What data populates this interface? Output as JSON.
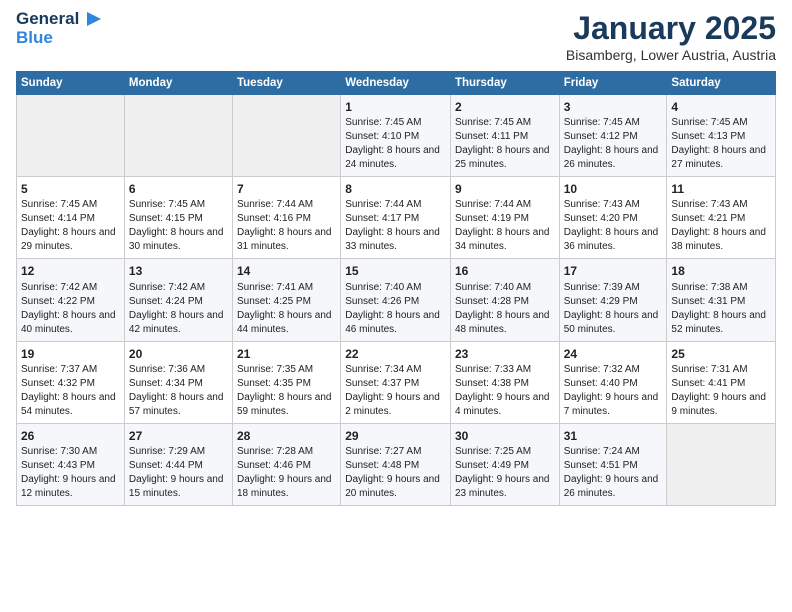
{
  "header": {
    "logo_line1": "General",
    "logo_line2": "Blue",
    "title": "January 2025",
    "location": "Bisamberg, Lower Austria, Austria"
  },
  "weekdays": [
    "Sunday",
    "Monday",
    "Tuesday",
    "Wednesday",
    "Thursday",
    "Friday",
    "Saturday"
  ],
  "weeks": [
    [
      {
        "day": "",
        "info": ""
      },
      {
        "day": "",
        "info": ""
      },
      {
        "day": "",
        "info": ""
      },
      {
        "day": "1",
        "info": "Sunrise: 7:45 AM\nSunset: 4:10 PM\nDaylight: 8 hours\nand 24 minutes."
      },
      {
        "day": "2",
        "info": "Sunrise: 7:45 AM\nSunset: 4:11 PM\nDaylight: 8 hours\nand 25 minutes."
      },
      {
        "day": "3",
        "info": "Sunrise: 7:45 AM\nSunset: 4:12 PM\nDaylight: 8 hours\nand 26 minutes."
      },
      {
        "day": "4",
        "info": "Sunrise: 7:45 AM\nSunset: 4:13 PM\nDaylight: 8 hours\nand 27 minutes."
      }
    ],
    [
      {
        "day": "5",
        "info": "Sunrise: 7:45 AM\nSunset: 4:14 PM\nDaylight: 8 hours\nand 29 minutes."
      },
      {
        "day": "6",
        "info": "Sunrise: 7:45 AM\nSunset: 4:15 PM\nDaylight: 8 hours\nand 30 minutes."
      },
      {
        "day": "7",
        "info": "Sunrise: 7:44 AM\nSunset: 4:16 PM\nDaylight: 8 hours\nand 31 minutes."
      },
      {
        "day": "8",
        "info": "Sunrise: 7:44 AM\nSunset: 4:17 PM\nDaylight: 8 hours\nand 33 minutes."
      },
      {
        "day": "9",
        "info": "Sunrise: 7:44 AM\nSunset: 4:19 PM\nDaylight: 8 hours\nand 34 minutes."
      },
      {
        "day": "10",
        "info": "Sunrise: 7:43 AM\nSunset: 4:20 PM\nDaylight: 8 hours\nand 36 minutes."
      },
      {
        "day": "11",
        "info": "Sunrise: 7:43 AM\nSunset: 4:21 PM\nDaylight: 8 hours\nand 38 minutes."
      }
    ],
    [
      {
        "day": "12",
        "info": "Sunrise: 7:42 AM\nSunset: 4:22 PM\nDaylight: 8 hours\nand 40 minutes."
      },
      {
        "day": "13",
        "info": "Sunrise: 7:42 AM\nSunset: 4:24 PM\nDaylight: 8 hours\nand 42 minutes."
      },
      {
        "day": "14",
        "info": "Sunrise: 7:41 AM\nSunset: 4:25 PM\nDaylight: 8 hours\nand 44 minutes."
      },
      {
        "day": "15",
        "info": "Sunrise: 7:40 AM\nSunset: 4:26 PM\nDaylight: 8 hours\nand 46 minutes."
      },
      {
        "day": "16",
        "info": "Sunrise: 7:40 AM\nSunset: 4:28 PM\nDaylight: 8 hours\nand 48 minutes."
      },
      {
        "day": "17",
        "info": "Sunrise: 7:39 AM\nSunset: 4:29 PM\nDaylight: 8 hours\nand 50 minutes."
      },
      {
        "day": "18",
        "info": "Sunrise: 7:38 AM\nSunset: 4:31 PM\nDaylight: 8 hours\nand 52 minutes."
      }
    ],
    [
      {
        "day": "19",
        "info": "Sunrise: 7:37 AM\nSunset: 4:32 PM\nDaylight: 8 hours\nand 54 minutes."
      },
      {
        "day": "20",
        "info": "Sunrise: 7:36 AM\nSunset: 4:34 PM\nDaylight: 8 hours\nand 57 minutes."
      },
      {
        "day": "21",
        "info": "Sunrise: 7:35 AM\nSunset: 4:35 PM\nDaylight: 8 hours\nand 59 minutes."
      },
      {
        "day": "22",
        "info": "Sunrise: 7:34 AM\nSunset: 4:37 PM\nDaylight: 9 hours\nand 2 minutes."
      },
      {
        "day": "23",
        "info": "Sunrise: 7:33 AM\nSunset: 4:38 PM\nDaylight: 9 hours\nand 4 minutes."
      },
      {
        "day": "24",
        "info": "Sunrise: 7:32 AM\nSunset: 4:40 PM\nDaylight: 9 hours\nand 7 minutes."
      },
      {
        "day": "25",
        "info": "Sunrise: 7:31 AM\nSunset: 4:41 PM\nDaylight: 9 hours\nand 9 minutes."
      }
    ],
    [
      {
        "day": "26",
        "info": "Sunrise: 7:30 AM\nSunset: 4:43 PM\nDaylight: 9 hours\nand 12 minutes."
      },
      {
        "day": "27",
        "info": "Sunrise: 7:29 AM\nSunset: 4:44 PM\nDaylight: 9 hours\nand 15 minutes."
      },
      {
        "day": "28",
        "info": "Sunrise: 7:28 AM\nSunset: 4:46 PM\nDaylight: 9 hours\nand 18 minutes."
      },
      {
        "day": "29",
        "info": "Sunrise: 7:27 AM\nSunset: 4:48 PM\nDaylight: 9 hours\nand 20 minutes."
      },
      {
        "day": "30",
        "info": "Sunrise: 7:25 AM\nSunset: 4:49 PM\nDaylight: 9 hours\nand 23 minutes."
      },
      {
        "day": "31",
        "info": "Sunrise: 7:24 AM\nSunset: 4:51 PM\nDaylight: 9 hours\nand 26 minutes."
      },
      {
        "day": "",
        "info": ""
      }
    ]
  ]
}
